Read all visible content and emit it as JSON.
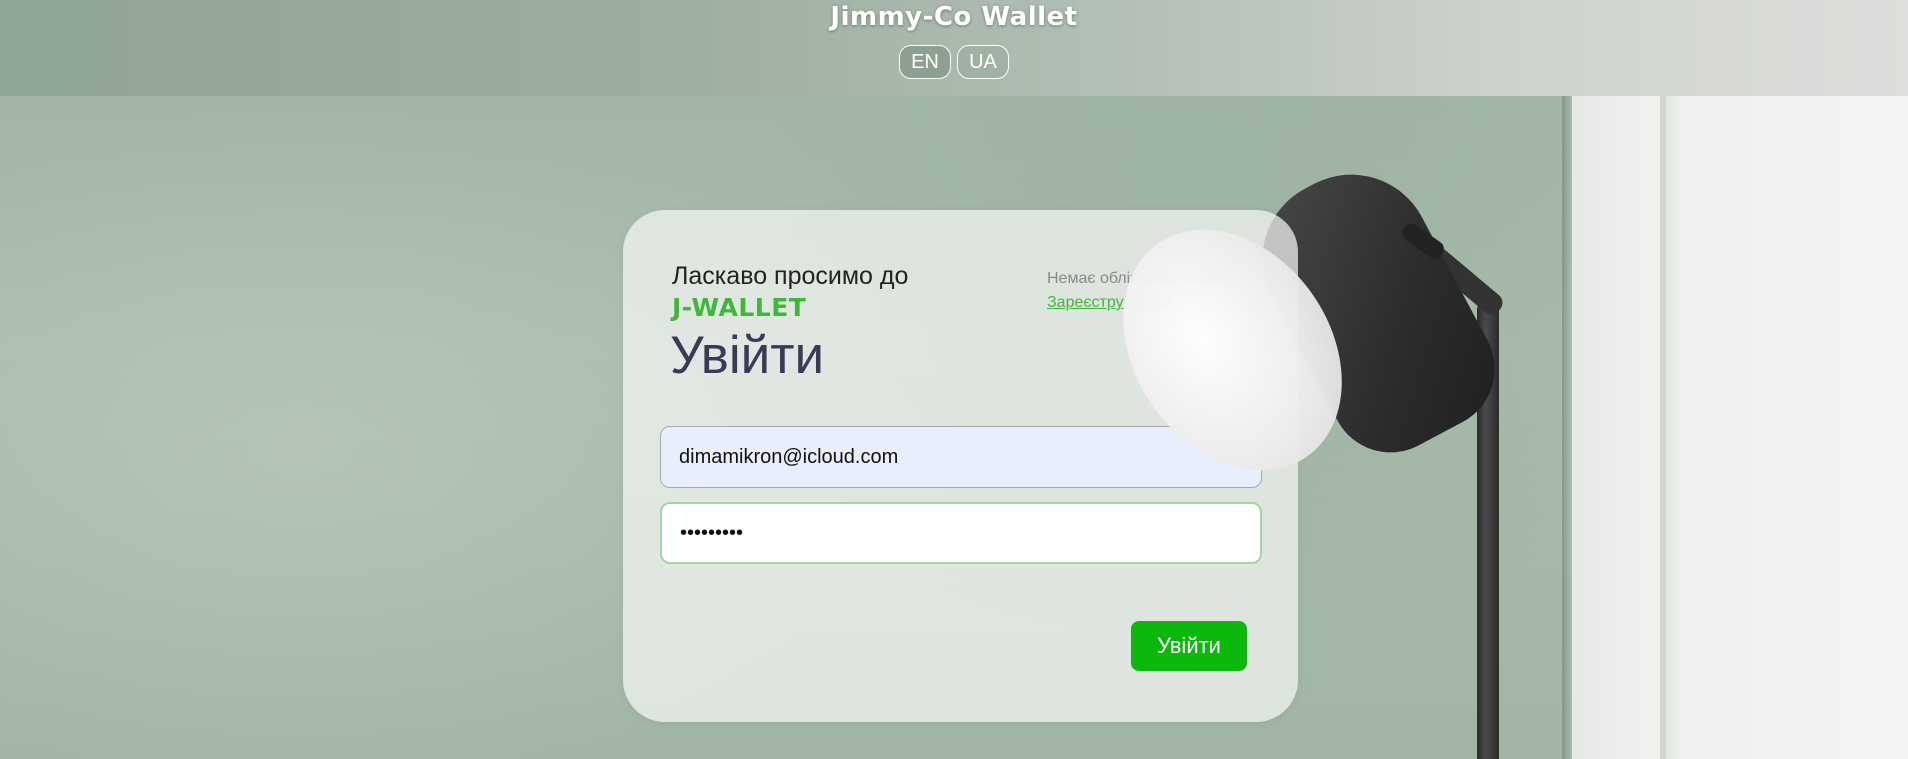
{
  "header": {
    "brand": "Jimmy-Co Wallet",
    "languages": [
      "EN",
      "UA"
    ]
  },
  "login": {
    "welcome": "Ласкаво просимо до",
    "brand_accent": "J-WALLET",
    "title": "Увійти",
    "no_account": "Немає облікового запису ?",
    "register_link": "Зареєструватися",
    "email_value": "dimamikron@icloud.com",
    "password_value": "•••••••••",
    "submit_label": "Увійти"
  },
  "colors": {
    "accent_green": "#3db83a",
    "button_green": "#0bb80b",
    "title_color": "#3a3a58"
  }
}
